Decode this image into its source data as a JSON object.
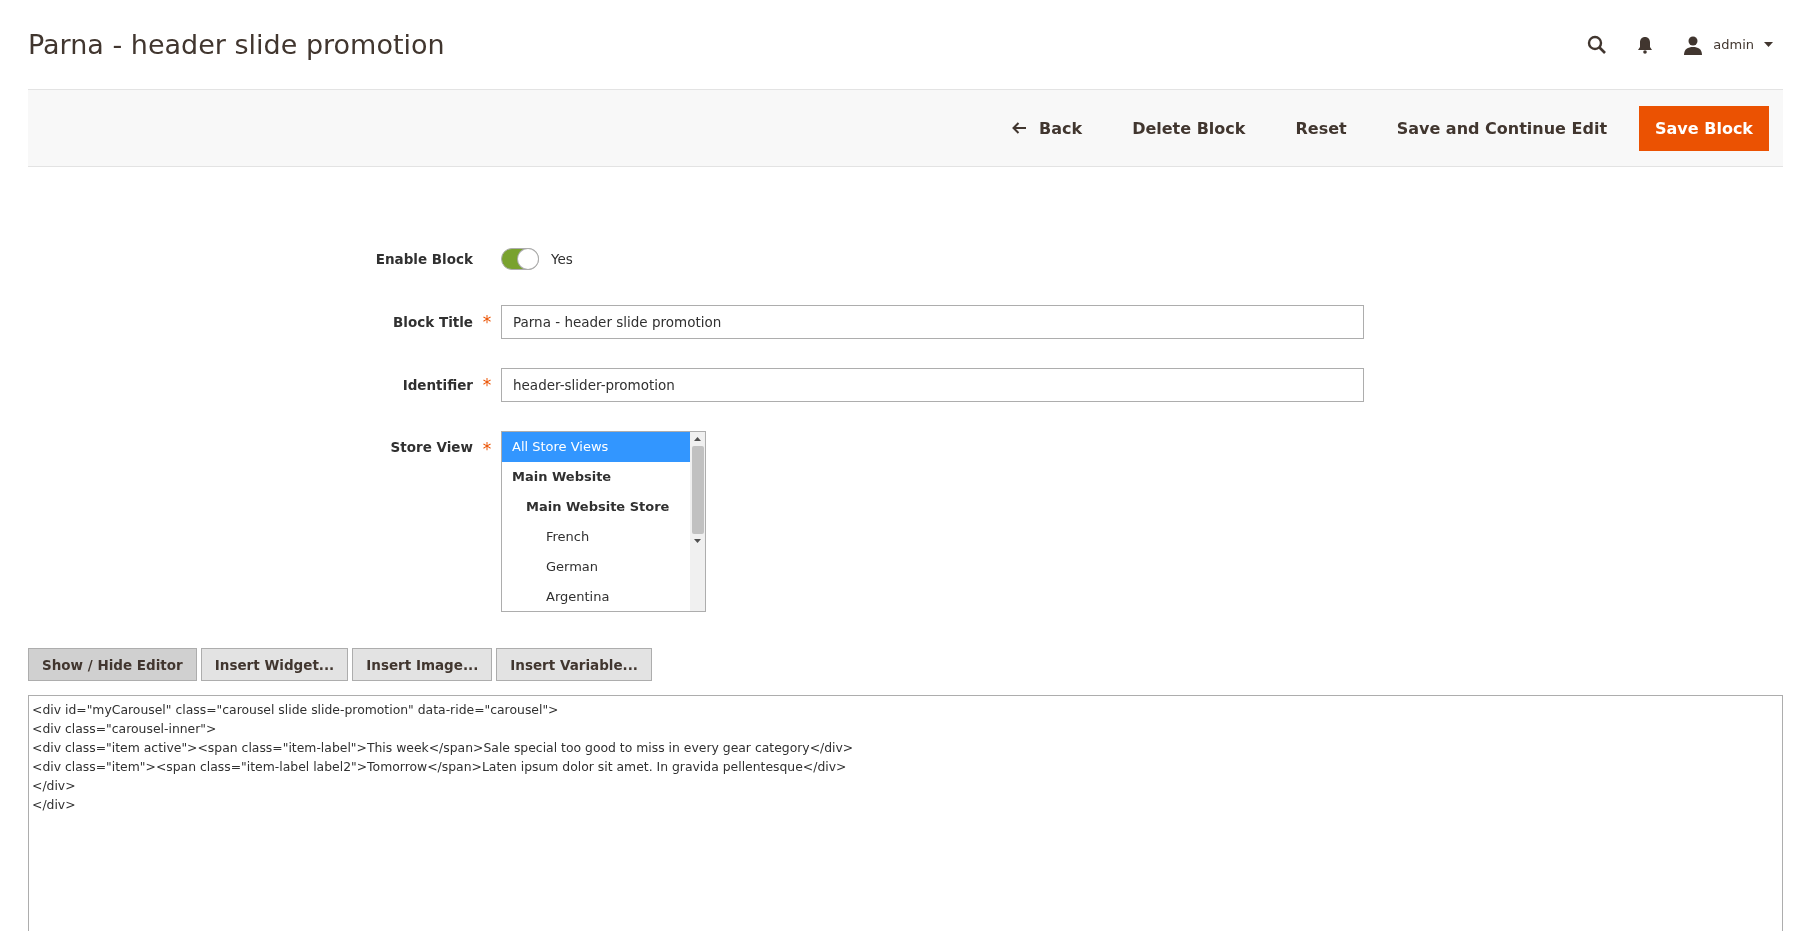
{
  "page_title": "Parna - header slide promotion",
  "header": {
    "user": "admin"
  },
  "actions": [
    {
      "label": "Back",
      "kind": "back"
    },
    {
      "label": "Delete Block",
      "kind": "plain"
    },
    {
      "label": "Reset",
      "kind": "plain"
    },
    {
      "label": "Save and Continue Edit",
      "kind": "plain"
    },
    {
      "label": "Save Block",
      "kind": "primary"
    }
  ],
  "form": {
    "enable": {
      "label": "Enable Block",
      "on": true,
      "value": "Yes"
    },
    "title": {
      "label": "Block Title",
      "required_mark": "*",
      "value": "Parna - header slide promotion"
    },
    "identifier": {
      "label": "Identifier",
      "required_mark": "*",
      "value": "header-slider-promotion"
    },
    "store_view": {
      "label": "Store View",
      "required_mark": "*",
      "options": [
        {
          "label": "All Store Views",
          "kind": "option",
          "selected": true
        },
        {
          "label": "Main Website",
          "kind": "group",
          "selected": false,
          "children": [
            {
              "label": "Main Website Store",
              "kind": "group",
              "selected": false,
              "children": [
                {
                  "label": "French",
                  "kind": "option",
                  "selected": false
                },
                {
                  "label": "German",
                  "kind": "option",
                  "selected": false
                },
                {
                  "label": "Argentina",
                  "kind": "option",
                  "selected": false
                }
              ]
            }
          ]
        }
      ]
    }
  },
  "editor_buttons": [
    "Show / Hide Editor",
    "Insert Widget...",
    "Insert Image...",
    "Insert Variable..."
  ],
  "editor_lines": [
    "<div id=\"myCarousel\" class=\"carousel slide slide-promotion\" data-ride=\"carousel\">",
    "<div class=\"carousel-inner\">",
    "<div class=\"item active\"><span class=\"item-label\">This week</span>Sale special too good to miss in every gear category</div>",
    "<div class=\"item\"><span class=\"item-label label2\">Tomorrow</span>Laten ipsum dolor sit amet. In gravida pellentesque</div>",
    "</div>",
    "</div>"
  ]
}
